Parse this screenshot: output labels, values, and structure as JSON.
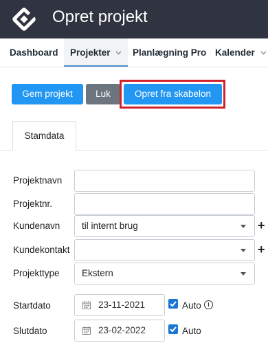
{
  "header": {
    "title": "Opret projekt"
  },
  "nav": {
    "items": [
      {
        "label": "Dashboard"
      },
      {
        "label": "Projekter"
      },
      {
        "label": "Planlægning Pro"
      },
      {
        "label": "Kalender"
      }
    ]
  },
  "toolbar": {
    "save_label": "Gem projekt",
    "close_label": "Luk",
    "template_label": "Opret fra skabelon"
  },
  "tabs": [
    {
      "label": "Stamdata"
    }
  ],
  "form": {
    "project_name": {
      "label": "Projektnavn",
      "value": ""
    },
    "project_no": {
      "label": "Projektnr.",
      "value": ""
    },
    "customer": {
      "label": "Kundenavn",
      "value": "til internt brug"
    },
    "contact": {
      "label": "Kundekontakt",
      "value": ""
    },
    "project_type": {
      "label": "Projekttype",
      "value": "Ekstern"
    },
    "start": {
      "label": "Startdato",
      "value": "23-11-2021",
      "auto_label": "Auto",
      "auto_checked": true
    },
    "end": {
      "label": "Slutdato",
      "value": "23-02-2022",
      "auto_label": "Auto",
      "auto_checked": true
    },
    "plus": "+"
  },
  "colors": {
    "header_bg": "#2f3440",
    "primary": "#2196f3",
    "secondary": "#6c757d",
    "highlight": "#d0212a"
  }
}
